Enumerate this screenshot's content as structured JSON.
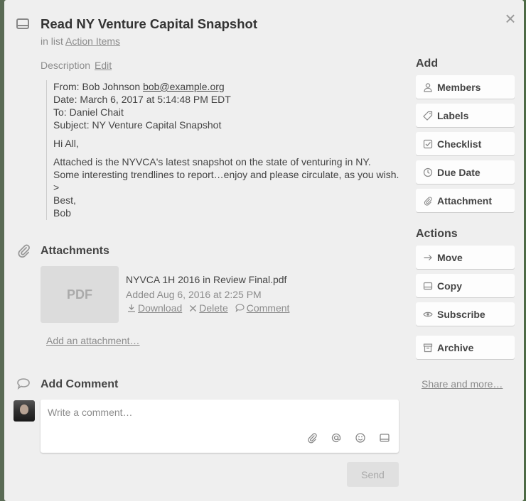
{
  "card": {
    "title": "Read NY Venture Capital Snapshot",
    "in_list_prefix": "in list",
    "list_name": "Action Items",
    "close_symbol": "×"
  },
  "description": {
    "label": "Description",
    "edit_label": "Edit",
    "from_prefix": "From: Bob Johnson",
    "from_email": "bob@example.org",
    "date": "Date: March 6, 2017 at 5:14:48 PM EDT",
    "to": "To: Daniel Chait",
    "subject": "Subject: NY Venture Capital Snapshot",
    "greeting": "Hi All,",
    "body_line1": "Attached is the NYVCA's latest snapshot on the state of venturing in NY.",
    "body_line2": "Some interesting trendlines to report…enjoy and please circulate, as you wish.",
    "quote_marker": ">",
    "signoff": "Best,",
    "signature": "Bob"
  },
  "attachments": {
    "heading": "Attachments",
    "items": [
      {
        "thumb_label": "PDF",
        "name": "NYVCA 1H 2016 in Review Final.pdf",
        "added": "Added Aug 6, 2016 at 2:25 PM",
        "download_label": "Download",
        "delete_label": "Delete",
        "comment_label": "Comment"
      }
    ],
    "add_label": "Add an attachment…"
  },
  "comment": {
    "heading": "Add Comment",
    "placeholder": "Write a comment…",
    "send_label": "Send",
    "tool_icons": [
      "paperclip-icon",
      "at-sign-icon",
      "smiley-icon",
      "card-icon"
    ]
  },
  "sidebar": {
    "add_heading": "Add",
    "add_buttons": [
      {
        "label": "Members",
        "icon": "person-icon"
      },
      {
        "label": "Labels",
        "icon": "tag-icon"
      },
      {
        "label": "Checklist",
        "icon": "checkbox-icon"
      },
      {
        "label": "Due Date",
        "icon": "clock-icon"
      },
      {
        "label": "Attachment",
        "icon": "paperclip-icon"
      }
    ],
    "actions_heading": "Actions",
    "action_buttons": [
      {
        "label": "Move",
        "icon": "arrow-right-icon"
      },
      {
        "label": "Copy",
        "icon": "card-icon"
      },
      {
        "label": "Subscribe",
        "icon": "eye-icon"
      },
      {
        "label": "Archive",
        "icon": "archive-icon"
      }
    ],
    "share_label": "Share and more…"
  },
  "colors": {
    "modal_bg": "#efefef",
    "button_bg": "#fdfdfd",
    "muted_text": "#8c8c8c",
    "heading_text": "#444444"
  }
}
